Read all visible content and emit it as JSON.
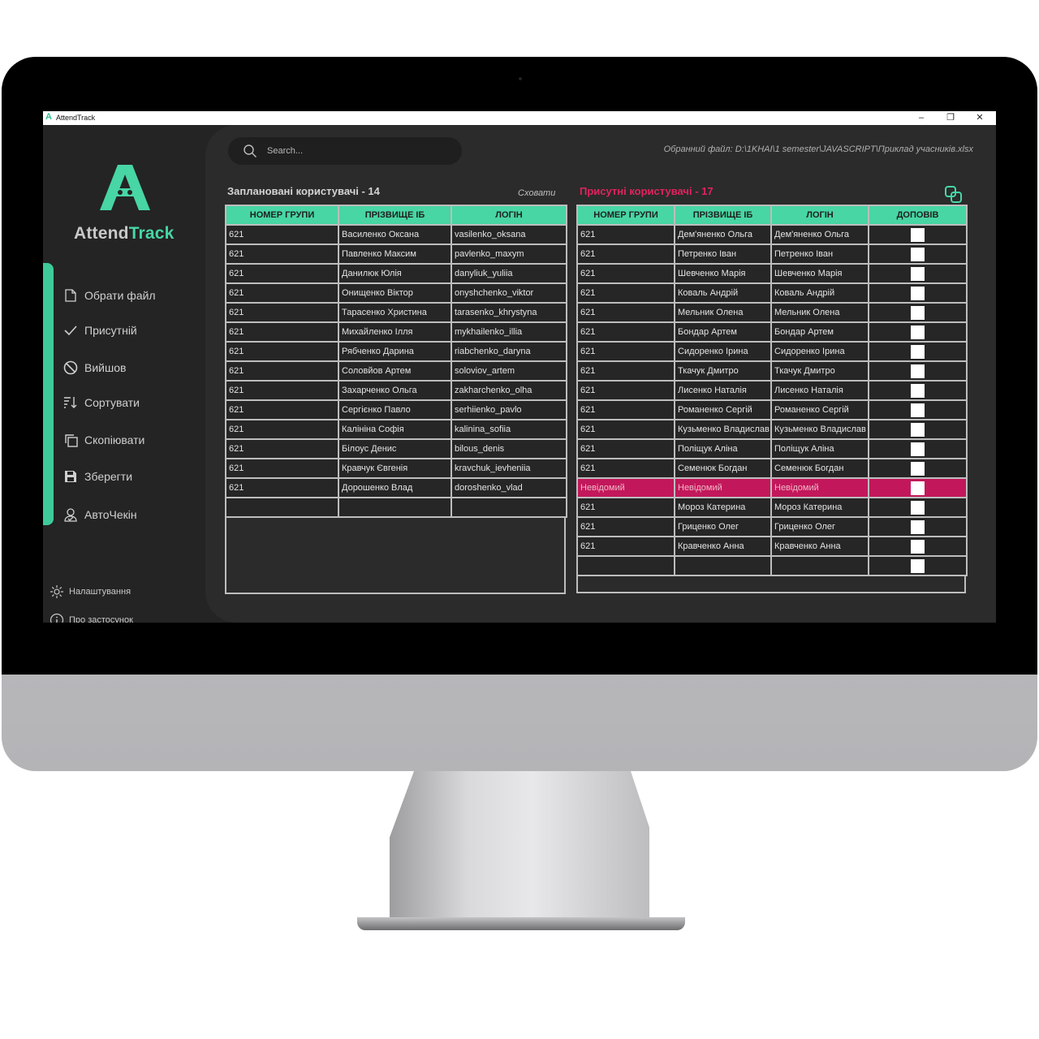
{
  "window": {
    "title": "AttendTrack",
    "icon": "app-logo-icon",
    "controls": [
      "minimize",
      "maximize",
      "close"
    ]
  },
  "brand": {
    "name_part1": "Attend",
    "name_part2": "Track",
    "accent_color": "#47d6a4",
    "alert_color": "#e0245e"
  },
  "nav": {
    "items": [
      {
        "label": "Обрати файл",
        "icon": "file-icon"
      },
      {
        "label": "Присутній",
        "icon": "check-icon"
      },
      {
        "label": "Вийшов",
        "icon": "ban-icon"
      },
      {
        "label": "Сортувати",
        "icon": "sort-icon"
      },
      {
        "label": "Скопіювати",
        "icon": "copy-icon"
      },
      {
        "label": "Зберегти",
        "icon": "save-icon"
      },
      {
        "label": "АвтоЧекін",
        "icon": "user-check-icon"
      }
    ],
    "settings_label": "Налаштування",
    "about_label": "Про застосунок"
  },
  "search": {
    "placeholder": "Search..."
  },
  "file_path": "Обранний файл: D:\\1KHAI\\1 semester\\JAVASCRIPT\\Приклад учасників.xlsx",
  "planned": {
    "title": "Заплановані користувачі - 14",
    "hide_label": "Сховати",
    "columns": [
      "НОМЕР ГРУПИ",
      "ПРІЗВИЩЕ ІБ",
      "ЛОГІН"
    ],
    "rows": [
      [
        "621",
        "Василенко Оксана",
        "vasilenko_oksana"
      ],
      [
        "621",
        "Павленко Максим",
        "pavlenko_maxym"
      ],
      [
        "621",
        "Данилюк Юлія",
        "danyliuk_yuliia"
      ],
      [
        "621",
        "Онищенко Віктор",
        "onyshchenko_viktor"
      ],
      [
        "621",
        "Тарасенко Христина",
        "tarasenko_khrystyna"
      ],
      [
        "621",
        "Михайленко Ілля",
        "mykhailenko_illia"
      ],
      [
        "621",
        "Рябченко Дарина",
        "riabchenko_daryna"
      ],
      [
        "621",
        "Соловйов Артем",
        "soloviov_artem"
      ],
      [
        "621",
        "Захарченко Ольга",
        "zakharchenko_olha"
      ],
      [
        "621",
        "Сергієнко Павло",
        "serhiienko_pavlo"
      ],
      [
        "621",
        "Калініна Софія",
        "kalinina_sofiia"
      ],
      [
        "621",
        "Білоус Денис",
        "bilous_denis"
      ],
      [
        "621",
        "Кравчук Євгенія",
        "kravchuk_ievheniia"
      ],
      [
        "621",
        "Дорошенко Влад",
        "doroshenko_vlad"
      ],
      [
        "",
        "",
        ""
      ]
    ]
  },
  "present": {
    "title": "Присутні користувачі - 17",
    "columns": [
      "НОМЕР ГРУПИ",
      "ПРІЗВИЩЕ ІБ",
      "ЛОГІН",
      "ДОПОВІВ"
    ],
    "rows": [
      [
        "621",
        "Дем'яненко Ольга",
        "Дем'яненко Ольга",
        false
      ],
      [
        "621",
        "Петренко Іван",
        "Петренко Іван",
        false
      ],
      [
        "621",
        "Шевченко Марія",
        "Шевченко Марія",
        false
      ],
      [
        "621",
        "Коваль Андрій",
        "Коваль Андрій",
        false
      ],
      [
        "621",
        "Мельник Олена",
        "Мельник Олена",
        false
      ],
      [
        "621",
        "Бондар Артем",
        "Бондар Артем",
        false
      ],
      [
        "621",
        "Сидоренко Ірина",
        "Сидоренко Ірина",
        false
      ],
      [
        "621",
        "Ткачук Дмитро",
        "Ткачук Дмитро",
        false
      ],
      [
        "621",
        "Лисенко Наталія",
        "Лисенко Наталія",
        false
      ],
      [
        "621",
        "Романенко Сергій",
        "Романенко Сергій",
        false
      ],
      [
        "621",
        "Кузьменко Владислав",
        "Кузьменко Владислав",
        false
      ],
      [
        "621",
        "Поліщук Аліна",
        "Поліщук Аліна",
        false
      ],
      [
        "621",
        "Семенюк Богдан",
        "Семенюк Богдан",
        false
      ],
      [
        "Невідомий",
        "Невідомий",
        "Невідомий",
        false
      ],
      [
        "621",
        "Мороз Катерина",
        "Мороз Катерина",
        false
      ],
      [
        "621",
        "Гриценко Олег",
        "Гриценко Олег",
        false
      ],
      [
        "621",
        "Кравченко Анна",
        "Кравченко Анна",
        false
      ],
      [
        "",
        "",
        "",
        false
      ]
    ],
    "highlight_value": "Невідомий"
  }
}
